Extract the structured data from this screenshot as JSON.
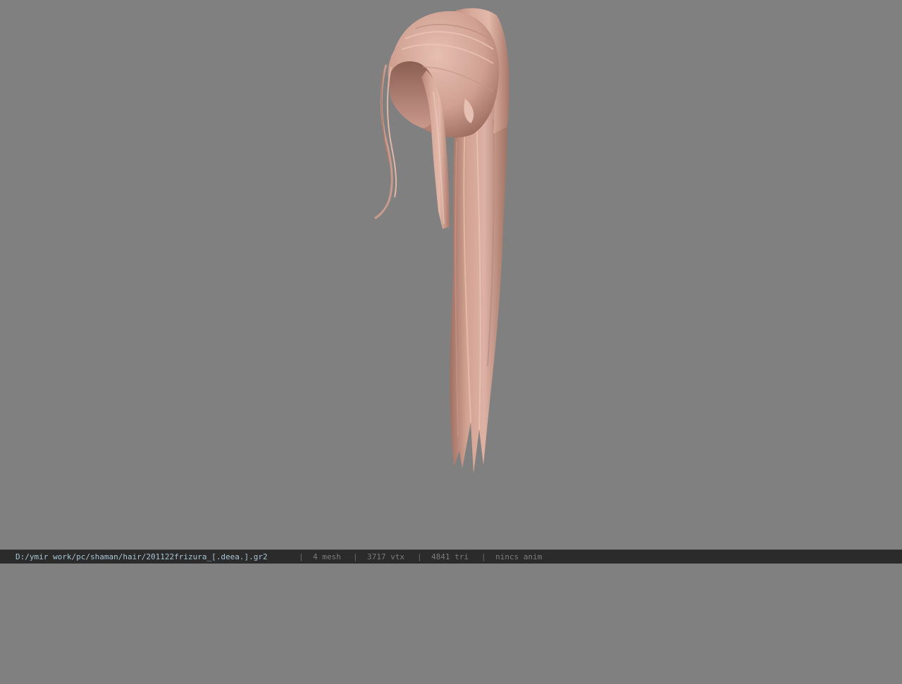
{
  "viewport": {
    "background": "#808080",
    "model": "hair-ponytail-mesh",
    "hair_color": "#d4a79a"
  },
  "status": {
    "file_path": "D:/ymir work/pc/shaman/hair/201122frizura_[.deea.].gr2",
    "separator": "|",
    "mesh": "4 mesh",
    "vtx": "3717 vtx",
    "tri": "4841 tri",
    "anim": "nincs anim"
  }
}
